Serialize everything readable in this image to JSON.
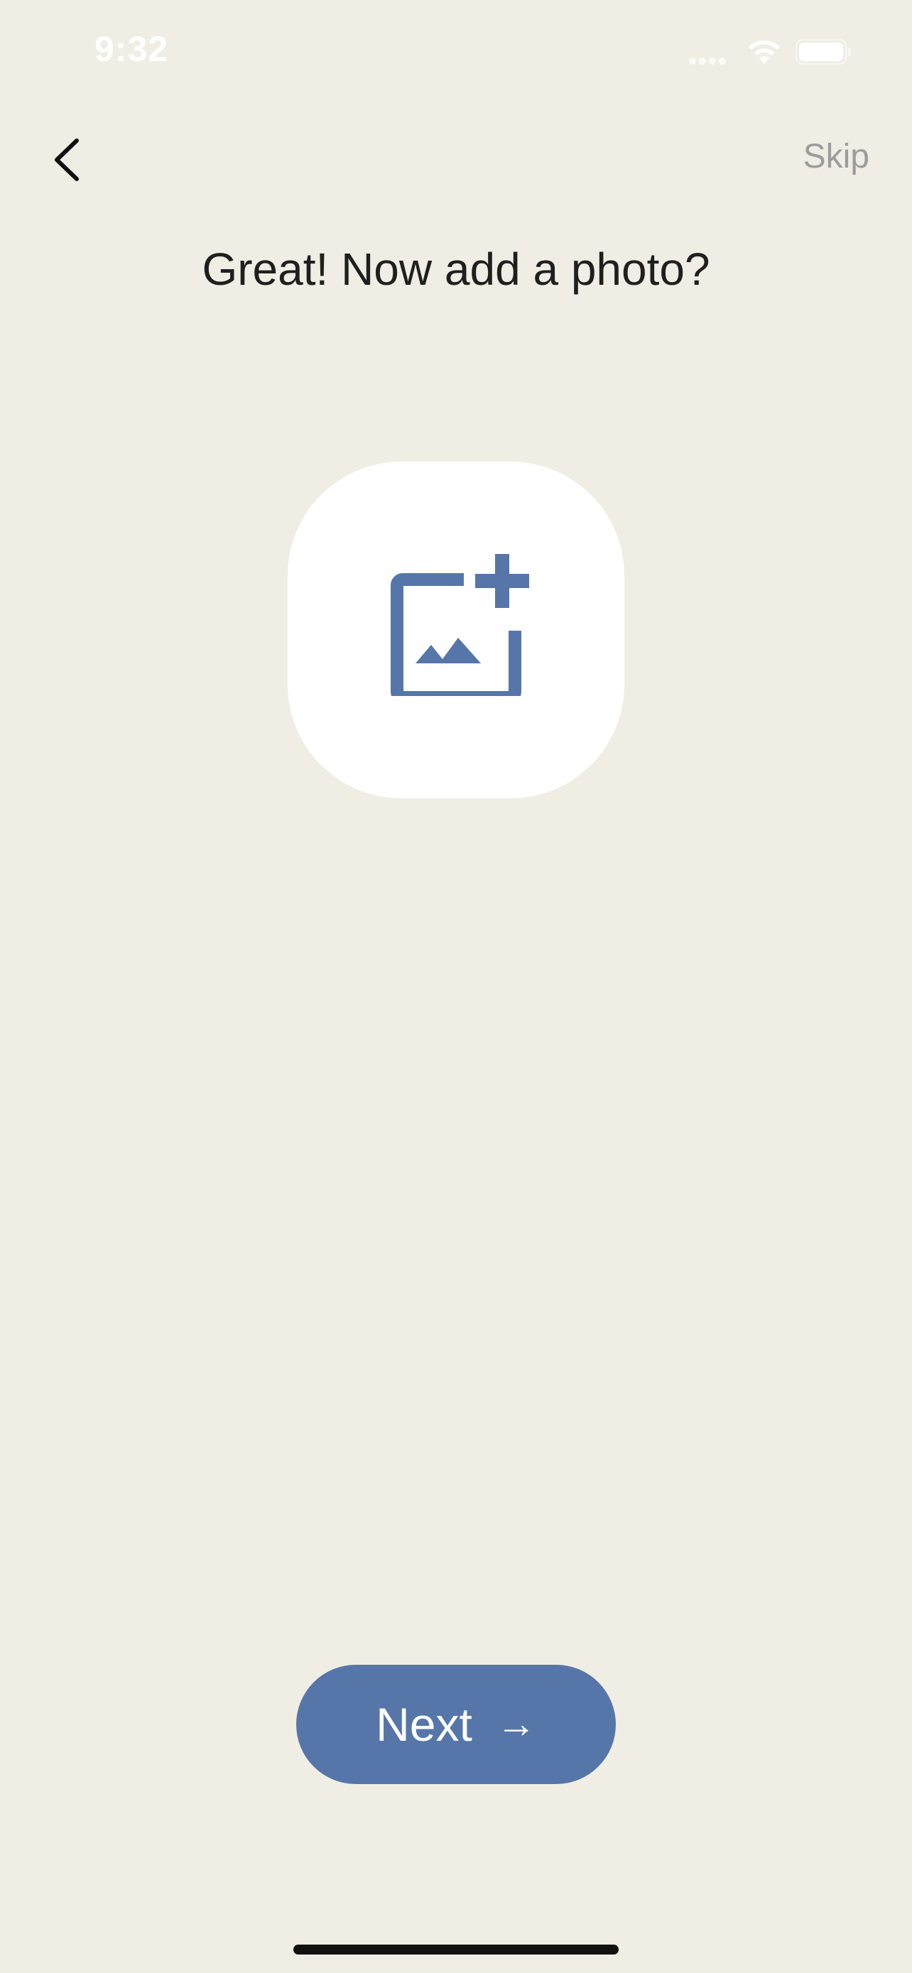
{
  "status_bar": {
    "time": "9:32"
  },
  "nav": {
    "back_icon": "chevron-left-icon",
    "skip_label": "Skip"
  },
  "main": {
    "title": "Great! Now add a photo?",
    "add_photo_icon": "add-photo-icon"
  },
  "footer": {
    "next_label": "Next",
    "next_arrow": "→"
  },
  "colors": {
    "background": "#F0EEE4",
    "accent": "#5676AA",
    "skip_text": "#9C9C9C",
    "title_text": "#1F1F1F"
  }
}
